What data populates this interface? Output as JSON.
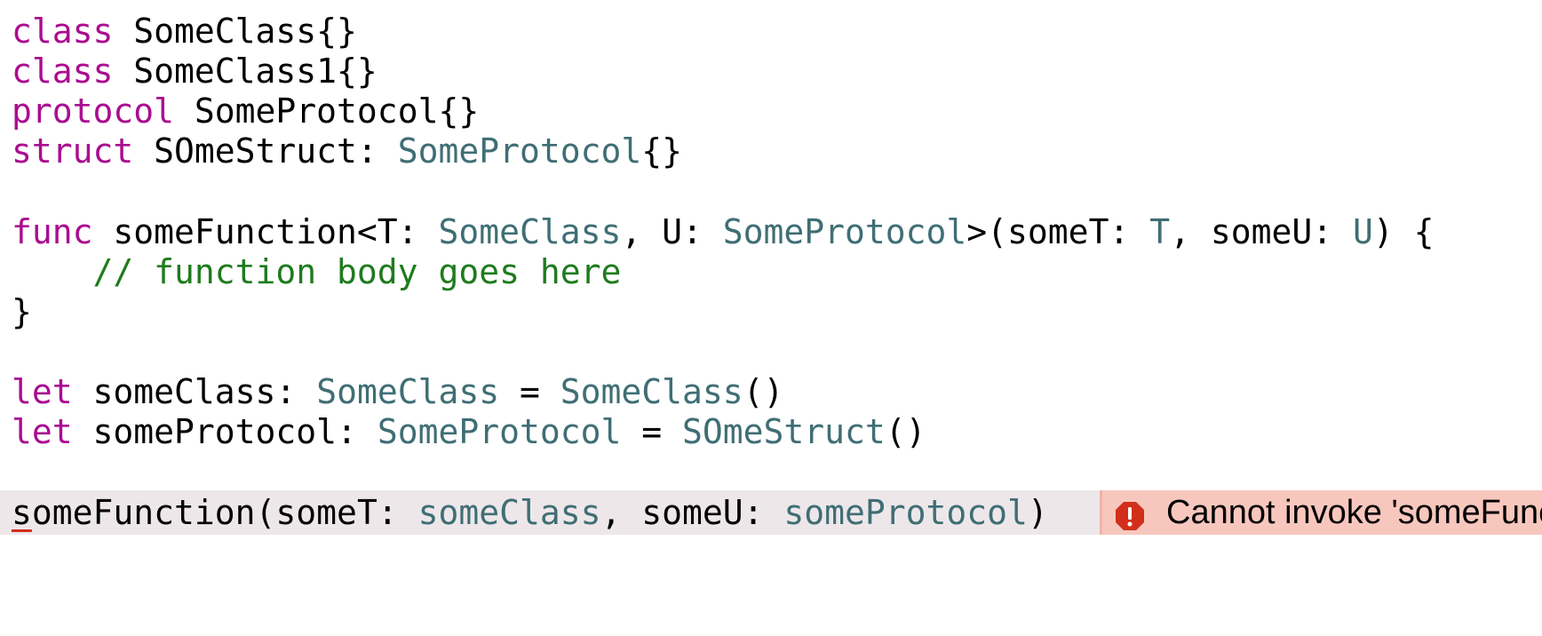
{
  "lines": [
    {
      "tokens": [
        {
          "t": "class",
          "k": "kw"
        },
        {
          "t": " SomeClass{}",
          "k": "pl"
        }
      ]
    },
    {
      "tokens": [
        {
          "t": "class",
          "k": "kw"
        },
        {
          "t": " SomeClass1{}",
          "k": "pl"
        }
      ]
    },
    {
      "tokens": [
        {
          "t": "protocol",
          "k": "kw"
        },
        {
          "t": " SomeProtocol{}",
          "k": "pl"
        }
      ]
    },
    {
      "tokens": [
        {
          "t": "struct",
          "k": "kw"
        },
        {
          "t": " SOmeStruct: ",
          "k": "pl"
        },
        {
          "t": "SomeProtocol",
          "k": "ty"
        },
        {
          "t": "{}",
          "k": "pl"
        }
      ]
    },
    {
      "tokens": []
    },
    {
      "tokens": [
        {
          "t": "func",
          "k": "kw"
        },
        {
          "t": " someFunction<T: ",
          "k": "pl"
        },
        {
          "t": "SomeClass",
          "k": "ty"
        },
        {
          "t": ", U: ",
          "k": "pl"
        },
        {
          "t": "SomeProtocol",
          "k": "ty"
        },
        {
          "t": ">(someT: ",
          "k": "pl"
        },
        {
          "t": "T",
          "k": "ty"
        },
        {
          "t": ", someU: ",
          "k": "pl"
        },
        {
          "t": "U",
          "k": "ty"
        },
        {
          "t": ") {",
          "k": "pl"
        }
      ]
    },
    {
      "tokens": [
        {
          "t": "    ",
          "k": "pl"
        },
        {
          "t": "// function body goes here",
          "k": "cm"
        }
      ]
    },
    {
      "tokens": [
        {
          "t": "}",
          "k": "pl"
        }
      ]
    },
    {
      "tokens": []
    },
    {
      "tokens": [
        {
          "t": "let",
          "k": "kw"
        },
        {
          "t": " someClass: ",
          "k": "pl"
        },
        {
          "t": "SomeClass",
          "k": "ty"
        },
        {
          "t": " = ",
          "k": "pl"
        },
        {
          "t": "SomeClass",
          "k": "ty"
        },
        {
          "t": "()",
          "k": "pl"
        }
      ]
    },
    {
      "tokens": [
        {
          "t": "let",
          "k": "kw"
        },
        {
          "t": " someProtocol: ",
          "k": "pl"
        },
        {
          "t": "SomeProtocol",
          "k": "ty"
        },
        {
          "t": " = ",
          "k": "pl"
        },
        {
          "t": "SOmeStruct",
          "k": "ty"
        },
        {
          "t": "()",
          "k": "pl"
        }
      ]
    },
    {
      "tokens": []
    },
    {
      "error": true,
      "tokens": [
        {
          "t": "s",
          "k": "pl",
          "underline": true
        },
        {
          "t": "omeFunction(someT: ",
          "k": "pl"
        },
        {
          "t": "someClass",
          "k": "ty"
        },
        {
          "t": ", someU: ",
          "k": "pl"
        },
        {
          "t": "someProtocol",
          "k": "ty"
        },
        {
          "t": ")",
          "k": "pl"
        }
      ]
    }
  ],
  "error": {
    "icon": "error-exclamation-icon",
    "message": "Cannot invoke 'someFunc",
    "bubble_color": "#f7c7bd",
    "icon_color": "#d12f1b"
  },
  "colors": {
    "keyword": "#aa0d91",
    "type": "#3f6e74",
    "comment": "#1e7b1e",
    "plain": "#000000",
    "error_line_bg": "#ede7ea"
  }
}
